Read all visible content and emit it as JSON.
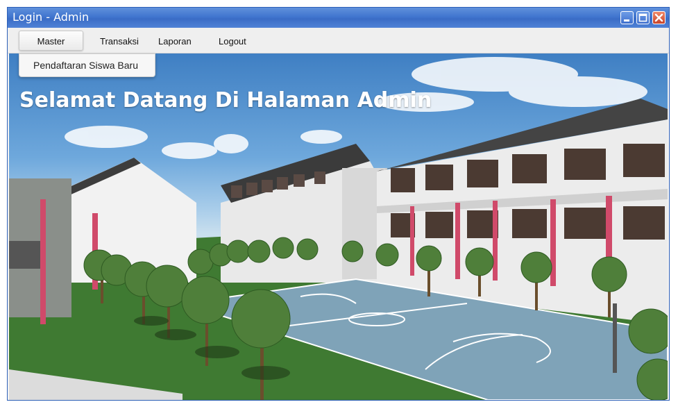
{
  "window": {
    "title": "Login - Admin"
  },
  "menu": {
    "items": [
      {
        "label": "Master"
      },
      {
        "label": "Transaksi"
      },
      {
        "label": "Laporan"
      },
      {
        "label": "Logout"
      }
    ],
    "dropdown": {
      "items": [
        {
          "label": "Pendaftaran Siswa Baru"
        }
      ]
    }
  },
  "main": {
    "heading": "Selamat Datang Di Halaman Admin"
  },
  "icons": {
    "minimize": "minimize-icon",
    "maximize": "maximize-icon",
    "close": "close-icon"
  },
  "colors": {
    "titlebar": "#4176cf",
    "close_button": "#c7442a",
    "court": "#7fa3b8",
    "grass": "#3f7a32"
  }
}
